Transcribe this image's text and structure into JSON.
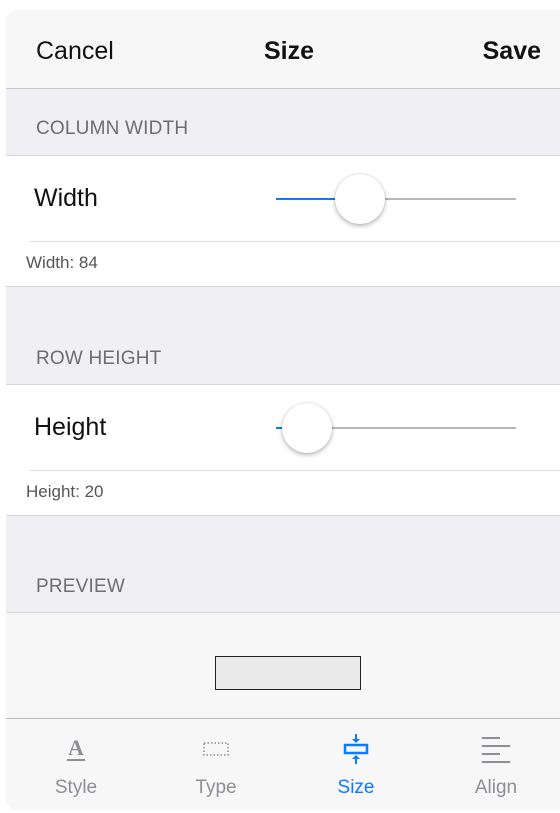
{
  "navbar": {
    "left_label": "Cancel",
    "title": "Size",
    "right_label": "Save"
  },
  "column_width": {
    "header": "COLUMN WIDTH",
    "label": "Width",
    "value_text": "Width: 84",
    "slider_fraction": 0.35
  },
  "row_height": {
    "header": "ROW HEIGHT",
    "label": "Height",
    "value_text": "Height: 20",
    "slider_fraction": 0.13
  },
  "preview": {
    "header": "PREVIEW"
  },
  "tabs": [
    {
      "label": "Style",
      "icon": "text-style-icon",
      "active": false
    },
    {
      "label": "Type",
      "icon": "dotted-box-icon",
      "active": false
    },
    {
      "label": "Size",
      "icon": "resize-height-icon",
      "active": true
    },
    {
      "label": "Align",
      "icon": "align-left-icon",
      "active": false
    }
  ],
  "colors": {
    "accent": "#0a7aff",
    "inactive": "#8e8e93",
    "background": "#efeff4"
  }
}
